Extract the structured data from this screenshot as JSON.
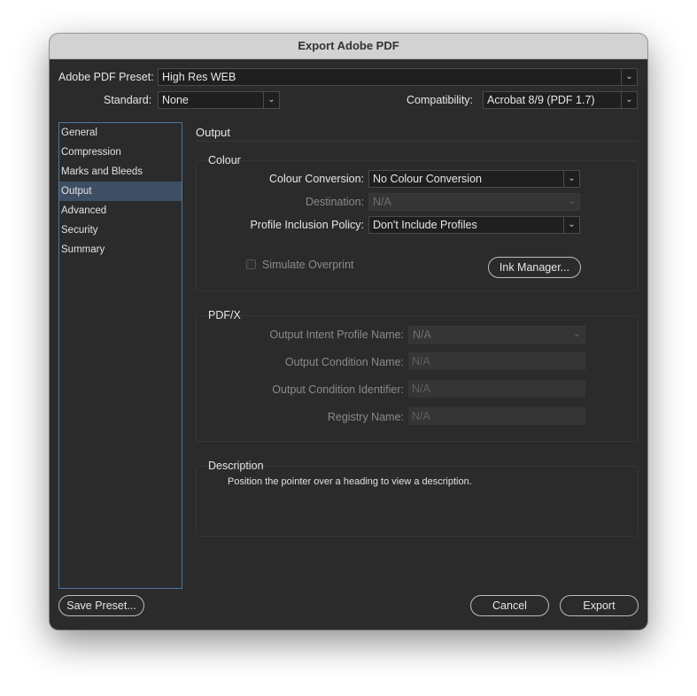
{
  "window": {
    "title": "Export Adobe PDF"
  },
  "preset": {
    "label": "Adobe PDF Preset:",
    "value": "High Res WEB"
  },
  "standard": {
    "label": "Standard:",
    "value": "None"
  },
  "compatibility": {
    "label": "Compatibility:",
    "value": "Acrobat 8/9 (PDF 1.7)"
  },
  "sidebar": {
    "items": [
      {
        "label": "General"
      },
      {
        "label": "Compression"
      },
      {
        "label": "Marks and Bleeds"
      },
      {
        "label": "Output",
        "active": true
      },
      {
        "label": "Advanced"
      },
      {
        "label": "Security"
      },
      {
        "label": "Summary"
      }
    ]
  },
  "main": {
    "heading": "Output",
    "colour": {
      "title": "Colour",
      "conversion_label": "Colour Conversion:",
      "conversion_value": "No Colour Conversion",
      "destination_label": "Destination:",
      "destination_value": "N/A",
      "profile_label": "Profile Inclusion Policy:",
      "profile_value": "Don't Include Profiles",
      "simulate_label": "Simulate Overprint",
      "ink_manager_label": "Ink Manager..."
    },
    "pdfx": {
      "title": "PDF/X",
      "intent_label": "Output Intent Profile Name:",
      "intent_value": "N/A",
      "condition_name_label": "Output Condition Name:",
      "condition_name_value": "N/A",
      "condition_id_label": "Output Condition Identifier:",
      "condition_id_value": "N/A",
      "registry_label": "Registry Name:",
      "registry_value": "N/A"
    },
    "description": {
      "title": "Description",
      "text": "Position the pointer over a heading to view a description."
    }
  },
  "footer": {
    "save_preset": "Save Preset...",
    "cancel": "Cancel",
    "export": "Export"
  },
  "colors": {
    "window_bg": "#2b2b2b",
    "titlebar_bg": "#d2d2d2",
    "selection": "#3f4f63",
    "focus_border": "#4a78a8"
  }
}
